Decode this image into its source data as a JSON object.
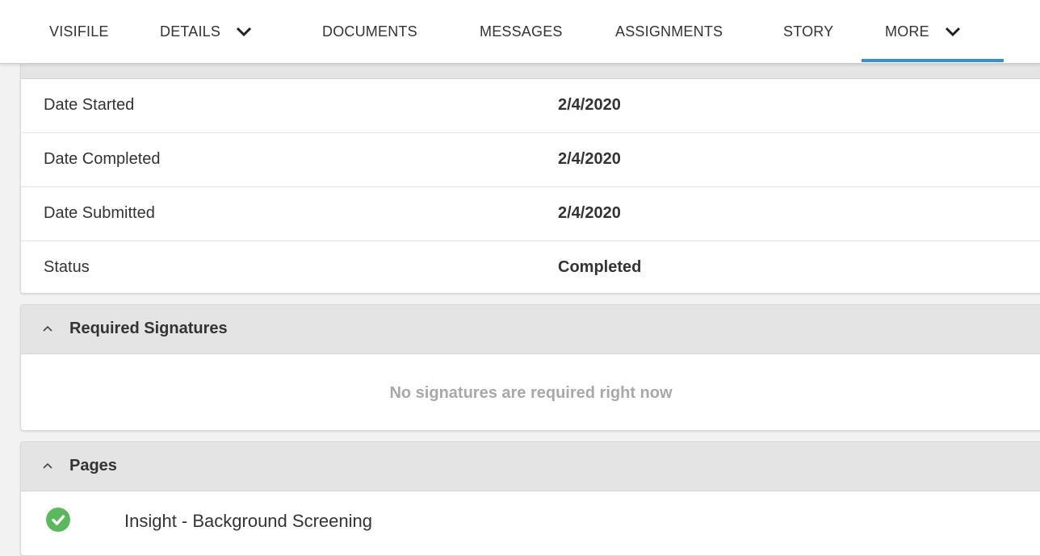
{
  "tabs": [
    {
      "label": "VISIFILE"
    },
    {
      "label": "DETAILS",
      "has_dropdown": true
    },
    {
      "label": "DOCUMENTS"
    },
    {
      "label": "MESSAGES"
    },
    {
      "label": "ASSIGNMENTS"
    },
    {
      "label": "STORY"
    },
    {
      "label": "MORE",
      "has_dropdown": true,
      "active": true
    }
  ],
  "colors": {
    "active_underline": "#2f8fdc",
    "check_green": "#5cb85c",
    "header_bg": "#e4e4e4",
    "muted_text": "#a8a8a8"
  },
  "details": {
    "rows": [
      {
        "label": "Date Started",
        "value": "2/4/2020"
      },
      {
        "label": "Date Completed",
        "value": "2/4/2020"
      },
      {
        "label": "Date Submitted",
        "value": "2/4/2020"
      },
      {
        "label": "Status",
        "value": "Completed"
      }
    ]
  },
  "signatures": {
    "title": "Required Signatures",
    "icon": "chevron-up-icon",
    "empty_message": "No signatures are required right now"
  },
  "pages": {
    "title": "Pages",
    "icon": "chevron-up-icon",
    "items": [
      {
        "label": "Insight - Background Screening",
        "status_icon": "check-circle-icon"
      }
    ]
  }
}
